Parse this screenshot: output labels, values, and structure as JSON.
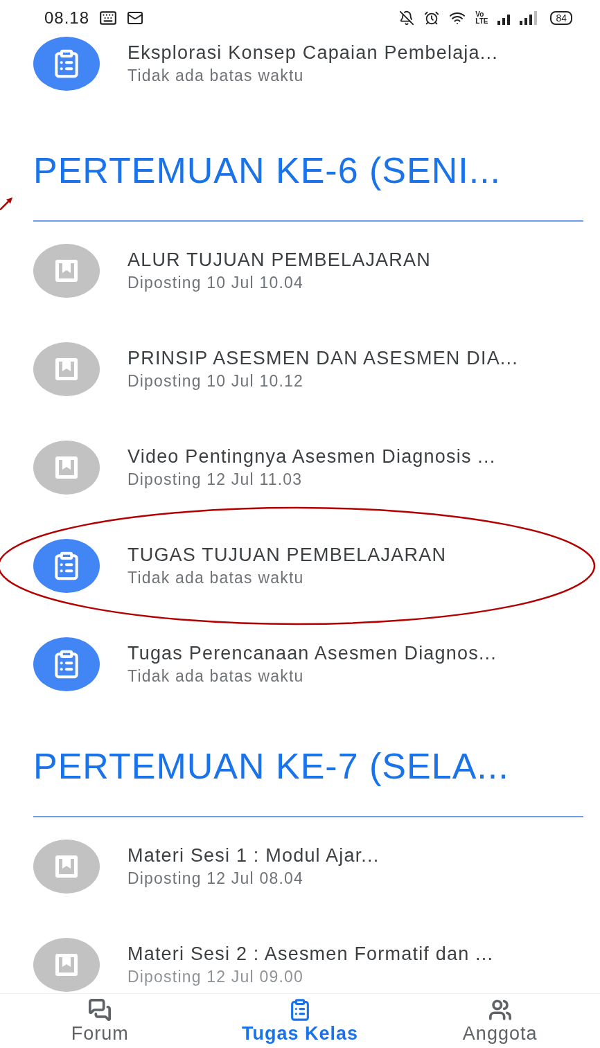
{
  "status_bar": {
    "time": "08.18",
    "network_labels": [
      "Vo",
      "LTE"
    ],
    "battery": "84"
  },
  "top_item": {
    "kind": "assignment",
    "title": "Eksplorasi Konsep Capaian Pembelaja...",
    "subtitle": "Tidak ada batas waktu",
    "highlighted": false
  },
  "sections": [
    {
      "title": "PERTEMUAN KE-6 (SENI...",
      "annotation_arrow": true,
      "items": [
        {
          "kind": "material",
          "title": "ALUR TUJUAN PEMBELAJARAN",
          "subtitle": "Diposting 10 Jul 10.04",
          "highlighted": false
        },
        {
          "kind": "material",
          "title": "PRINSIP ASESMEN DAN ASESMEN DIA...",
          "subtitle": "Diposting 10 Jul 10.12",
          "highlighted": false
        },
        {
          "kind": "material",
          "title": "Video Pentingnya Asesmen Diagnosis ...",
          "subtitle": "Diposting 12 Jul 11.03",
          "highlighted": false
        },
        {
          "kind": "assignment",
          "title": "TUGAS TUJUAN PEMBELAJARAN",
          "subtitle": "Tidak ada batas waktu",
          "highlighted": true
        },
        {
          "kind": "assignment",
          "title": "Tugas Perencanaan Asesmen Diagnos...",
          "subtitle": "Tidak ada batas waktu",
          "highlighted": false
        }
      ]
    },
    {
      "title": "PERTEMUAN KE-7 (SELA...",
      "annotation_arrow": false,
      "items": [
        {
          "kind": "material",
          "title": "Materi Sesi 1 : Modul Ajar...",
          "subtitle": "Diposting 12 Jul 08.04",
          "highlighted": false
        },
        {
          "kind": "material",
          "title": "Materi Sesi 2 : Asesmen Formatif dan ...",
          "subtitle": "Diposting 12 Jul 09.00",
          "highlighted": false
        }
      ]
    }
  ],
  "bottom_nav": [
    {
      "kind": "forum",
      "label": "Forum",
      "selected": false
    },
    {
      "kind": "classwork",
      "label": "Tugas Kelas",
      "selected": true
    },
    {
      "kind": "people",
      "label": "Anggota",
      "selected": false
    }
  ]
}
